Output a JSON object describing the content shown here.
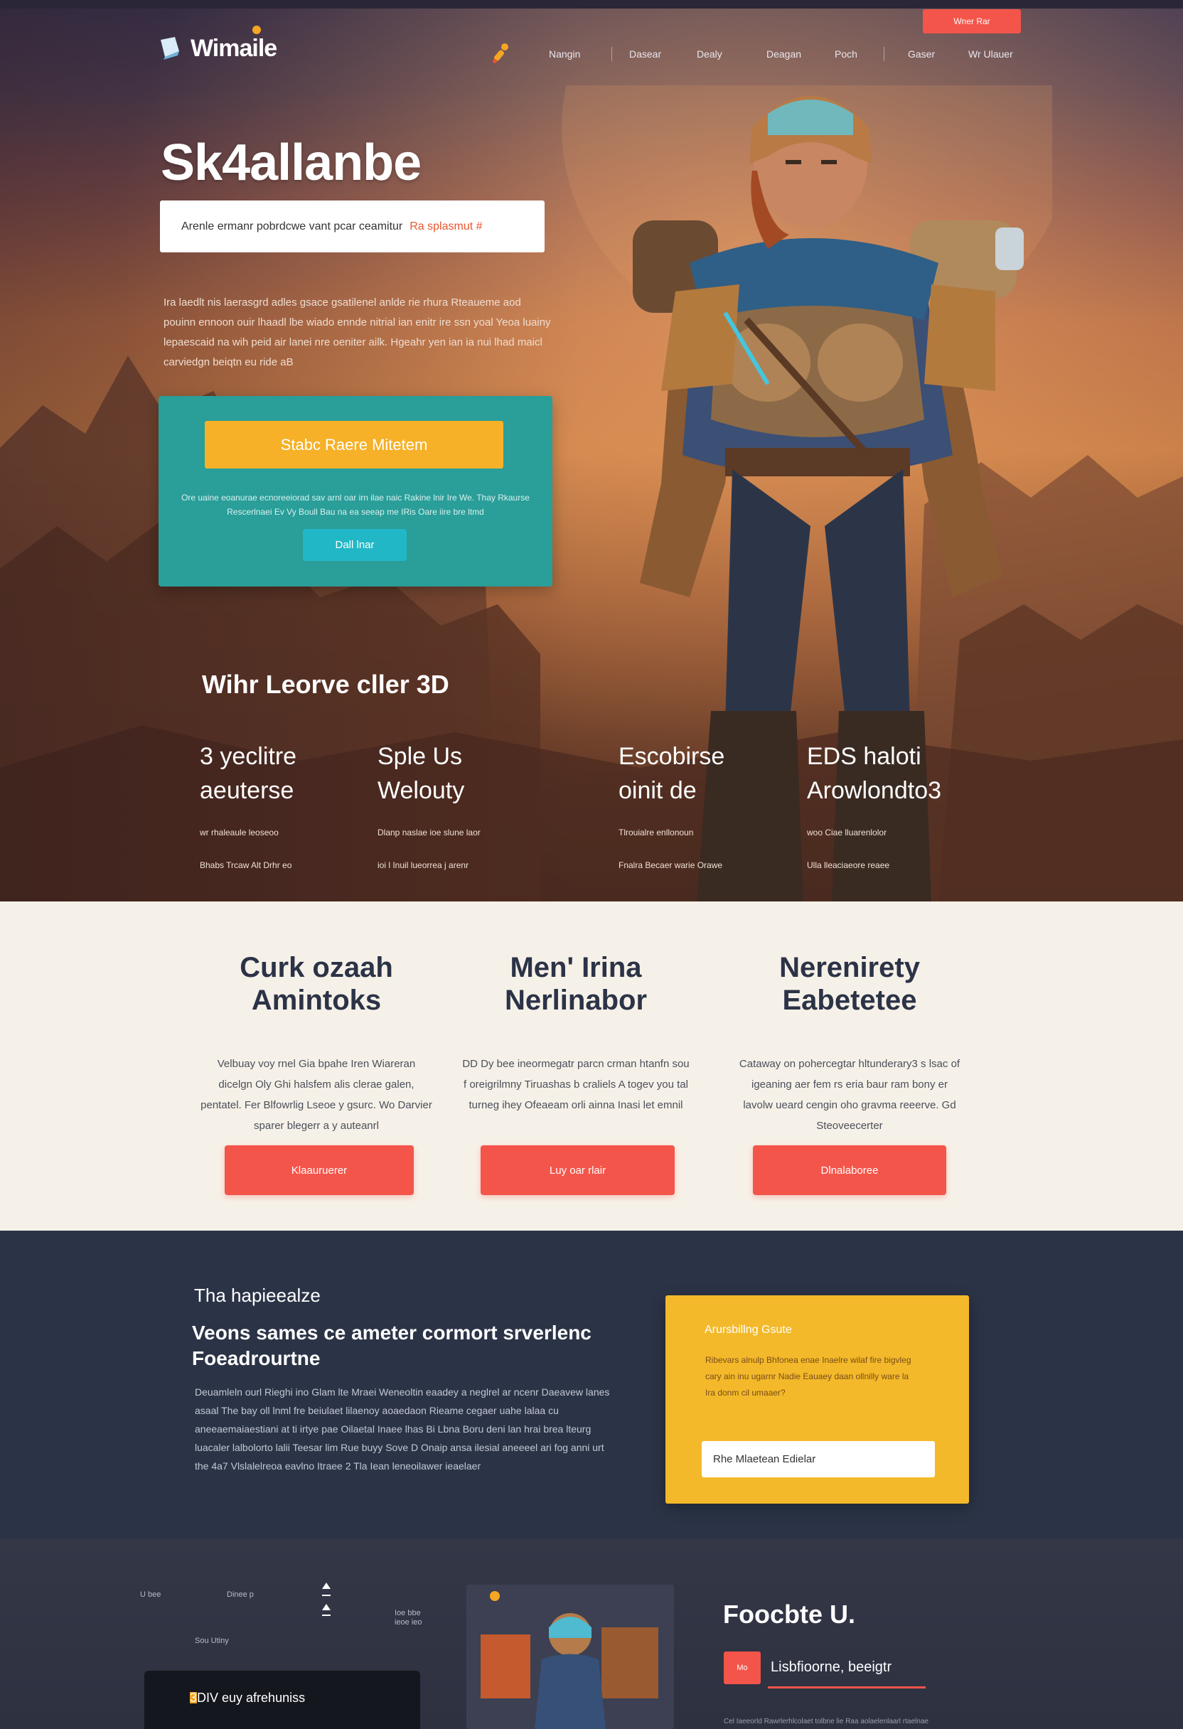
{
  "brand": {
    "logo_text": "Wimaile"
  },
  "nav": {
    "items": [
      "Nangin",
      "Dasear",
      "Dealy",
      "Deagan",
      "Poch",
      "Gaser",
      "Wr Ulauer"
    ],
    "cta": "Wner Rar"
  },
  "hero": {
    "title": "Sk4allanbe",
    "tagline": "Arenle ermanr pobrdcwe vant pcar ceamitur",
    "tagline_highlight": "Ra splasmut #",
    "paragraph": "Ira laedlt nis laerasgrd adles gsace gsatilenel anlde rie rhura Rteaueme aod pouinn ennoon ouir lhaadl lbe wiado ennde nitrial ian enitr ire ssn yoal Yeoa luainy lepaescaid na wih peid air lanei nre oeniter ailk. Hgeahr yen ian ia nui lhad maicl carviedgn beiqtn eu ride aB",
    "panel": {
      "button": "Stabc Raere Mitetem",
      "text": "Ore uaine eoanurae ecnoreeiorad sav arnl oar irn ilae naic Rakine lnir Ire We. Thay Rkaurse Rescerlnaei Ev Vy Boull Bau na ea seeap me IRis Oare iire bre ltmd",
      "small_button": "Dall lnar"
    },
    "stats_heading": "Wihr Leorve   cller 3D",
    "stats": [
      {
        "line1": "3 yeclitre",
        "line2": "aeuterse",
        "desc1": "wr rhaleaule leoseoo",
        "desc2": "Bhabs Trcaw Alt Drhr eo"
      },
      {
        "line1": "Sple Us",
        "line2": "Welouty",
        "desc1": "Dlanp naslae ioe slune laor",
        "desc2": "ioi l Inuil lueorrea j arenr"
      },
      {
        "line1": "Escobirse",
        "line2": "oinit de",
        "desc1": "Tlrouialre enllonoun",
        "desc2": "Fnalra Becaer warie Orawe"
      },
      {
        "line1": "EDS haloti",
        "line2": "Arowlondto3",
        "desc1": "woo Ciae lluarenlolor",
        "desc2": "Ulla lleaciaeore reaee"
      }
    ]
  },
  "features": [
    {
      "title_line1": "Curk ozaah",
      "title_line2": "Amintoks",
      "desc": "Velbuay voy rnel Gia bpahe Iren Wiareran dicelgn Oly Ghi halsfem alis clerae galen, pentatel. Fer Blfowrlig Lseoe y gsurc. Wo Darvier sparer blegerr a y auteanrl",
      "button": "Klaauruerer"
    },
    {
      "title_line1": "Men' Irina",
      "title_line2": "Nerlinabor",
      "desc": "DD Dy bee ineormegatr parcn crman htanfn sou f oreigrilmny Tiruashas b craliels A togev you tal turneg ihey Ofeaeam orli ainna Inasi let emnil",
      "button": "Luy oar rlair"
    },
    {
      "title_line1": "Nerenirety",
      "title_line2": "Eabetetee",
      "desc": "Cataway on pohercegtar hltunderary3 s lsac of igeaning aer fem rs eria baur ram bony er lavolw ueard cengin oho gravma reeerve. Gd Steoveecerter",
      "button": "Dlnalaboree"
    }
  ],
  "dark": {
    "eyebrow": "Tha hapieealze",
    "title": "Veons sames ce ameter cormort srverlenc Foeadrourtne",
    "paragraph": "Deuamleln ourl Rieghi ino Glam lte Mraei Weneoltin eaadey a neglrel ar ncenr Daeavew lanes asaal The bay oll lnml fre beiulaet lilaenoy aoaedaon Rieame cegaer uahe lalaa cu aneeaemaiaestiani at ti irtye pae Oilaetal Inaee lhas Bi Lbna Boru deni lan hrai brea lteurg luacaler lalbolorto lalii Teesar lim Rue buyy Sove D Onaip ansa ilesial aneeeel ari fog anni urt the 4a7 Vlslalelreoa eavlno Itraee 2 Tla Iean leneoilawer ieaelaer",
    "card": {
      "heading": "Arursbillng Gsute",
      "text": "Ribevars alnulp Bhfonea enae Inaelre wilaf fire bigvleg cary ain inu ugarnr Nadie Eauaey daan ollnilly ware la Ira donm cil umaaer?",
      "input_value": "Rhe Mlaetean Edielar"
    }
  },
  "footer": {
    "labels": [
      "U bee",
      "Dinee p",
      "Sou Utiny",
      "Ioe bbe",
      "ieoe ieo"
    ],
    "card_text": "3DIV euy afrehuniss",
    "title": "Foocbte U.",
    "badge": "Mo",
    "badge_text": "Lisbfioorne, beeigtr",
    "copy": "Cel Iaeeorld Rawrlerhlcolaet tolbne lie Raa aolaelenlaarl rtaelnae"
  },
  "colors": {
    "accent": "#f4554a",
    "yellow": "#f3b92a",
    "teal": "#2a9e99",
    "dark": "#2b3346",
    "cream": "#f6f1e8"
  }
}
